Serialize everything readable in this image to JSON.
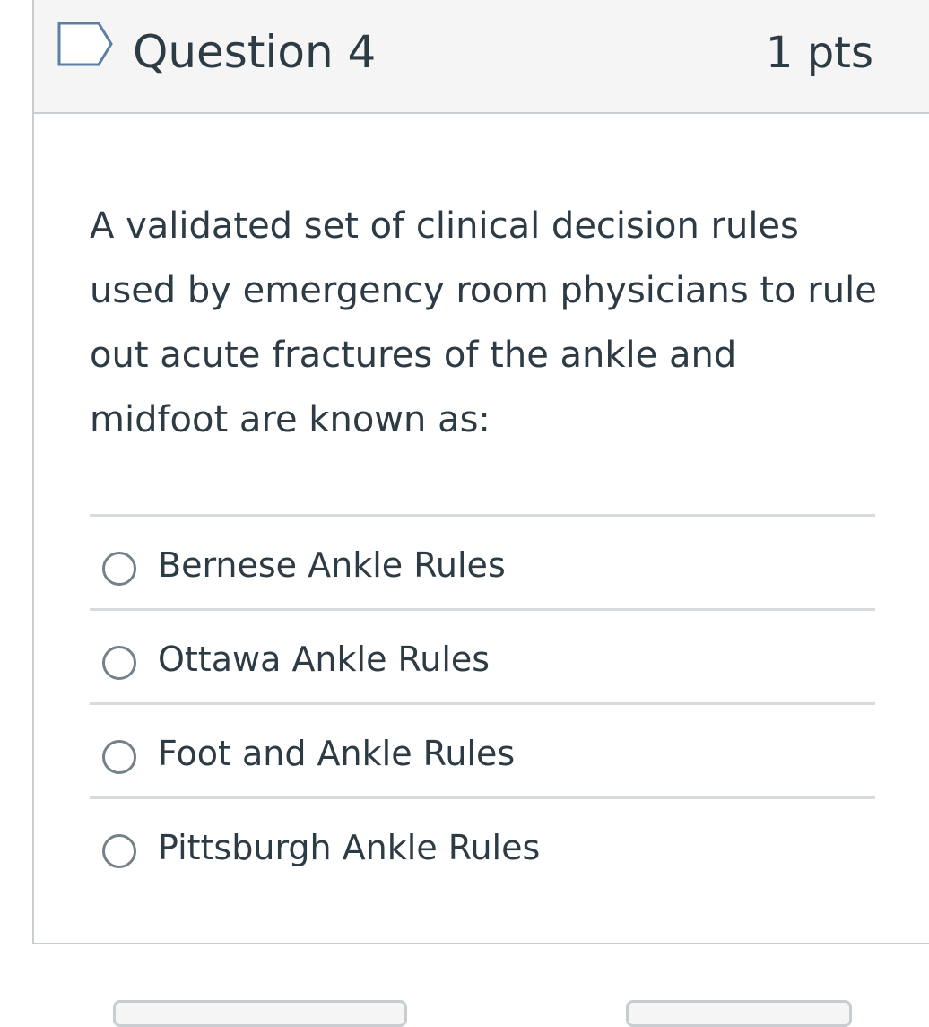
{
  "question": {
    "title": "Question 4",
    "points": "1 pts",
    "flag_icon": "flag-outline-icon",
    "text": "A validated set of clinical decision rules used by emergency room physicians to rule out acute fractures of the ankle and midfoot are known as:"
  },
  "answers": [
    {
      "label": "Bernese Ankle Rules",
      "selected": false
    },
    {
      "label": "Ottawa Ankle Rules",
      "selected": false
    },
    {
      "label": "Foot and Ankle Rules",
      "selected": false
    },
    {
      "label": "Pittsburgh Ankle Rules",
      "selected": false
    }
  ],
  "colors": {
    "text": "#2d3b45",
    "header_background": "#f5f5f5",
    "border": "#c7cdd1",
    "divider": "#d7dbde",
    "radio_border": "#73818a"
  }
}
